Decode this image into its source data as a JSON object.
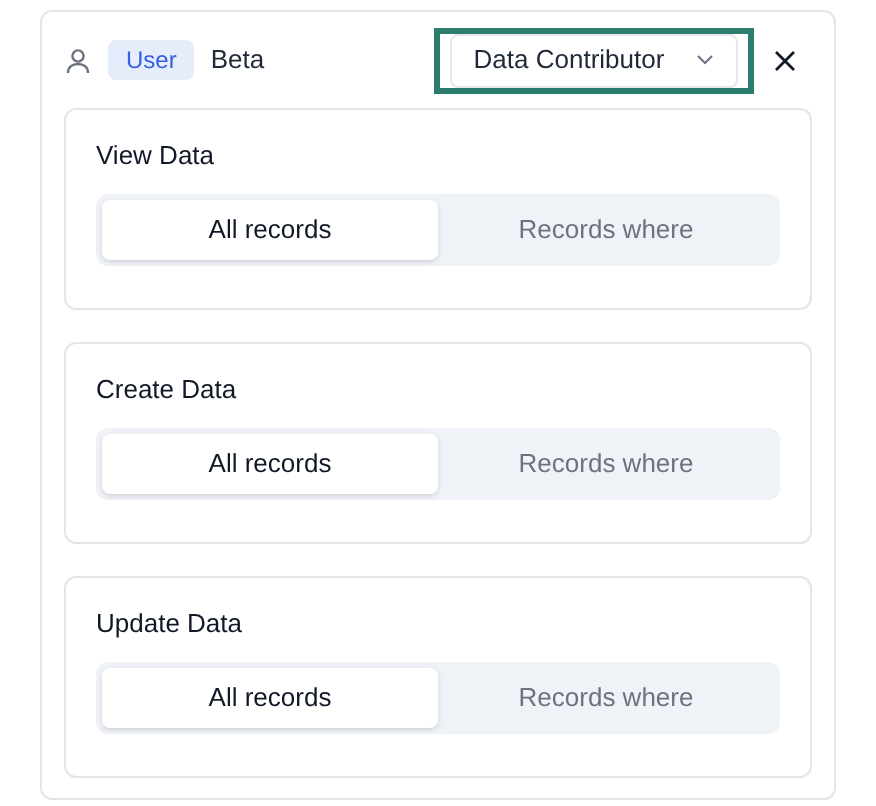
{
  "header": {
    "badge": "User",
    "name": "Beta",
    "role_dropdown": {
      "value": "Data Contributor",
      "highlighted": true
    }
  },
  "sections": [
    {
      "title": "View Data",
      "options": [
        {
          "label": "All records",
          "selected": true
        },
        {
          "label": "Records where",
          "selected": false
        }
      ]
    },
    {
      "title": "Create Data",
      "options": [
        {
          "label": "All records",
          "selected": true
        },
        {
          "label": "Records where",
          "selected": false
        }
      ]
    },
    {
      "title": "Update Data",
      "options": [
        {
          "label": "All records",
          "selected": true
        },
        {
          "label": "Records where",
          "selected": false
        }
      ]
    }
  ]
}
